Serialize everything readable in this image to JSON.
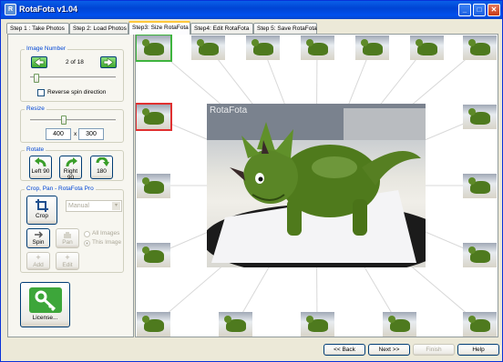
{
  "window": {
    "title": "RotaFota v1.04",
    "icon": "rotafota-app-icon",
    "min": "_",
    "max": "□",
    "close": "✕",
    "app_icon_text": "R"
  },
  "tabs": [
    {
      "label": "Step 1 : Take Photos",
      "active": false
    },
    {
      "label": "Step 2: Load Photos",
      "active": false
    },
    {
      "label": "Step3: Size RotaFota",
      "active": true
    },
    {
      "label": "Step4: Edit RotaFota",
      "active": false
    },
    {
      "label": "Step 5: Save RotaFota",
      "active": false
    }
  ],
  "image_number": {
    "title": "Image Number",
    "counter": "2 of 18",
    "reverse_label": "Reverse spin direction",
    "reverse_checked": false,
    "slider_fraction": 0.06
  },
  "resize": {
    "title": "Resize",
    "width": "400",
    "x": "x",
    "height": "300",
    "slider_fraction": 0.4
  },
  "rotate": {
    "title": "Rotate",
    "left": "Left 90",
    "right": "Right 90",
    "r180": "180"
  },
  "crop": {
    "title": "Crop, Pan - RotaFota Pro",
    "crop_label": "Crop",
    "mode": "Manual",
    "spin": "Spin",
    "pan": "Pan",
    "all_images": "All Images",
    "this_image": "This Image",
    "add": "Add",
    "edit": "Edit"
  },
  "license": {
    "label": "License..."
  },
  "viewer": {
    "watermark": "RotaFota"
  },
  "bottom": {
    "back": "<< Back",
    "next": "Next >>",
    "finish": "Finish",
    "help": "Help"
  },
  "colors": {
    "accent": "#0046D5",
    "selected_thumb": "#3EB43E",
    "current_thumb": "#E03030",
    "title_bar": "#0050EE"
  }
}
